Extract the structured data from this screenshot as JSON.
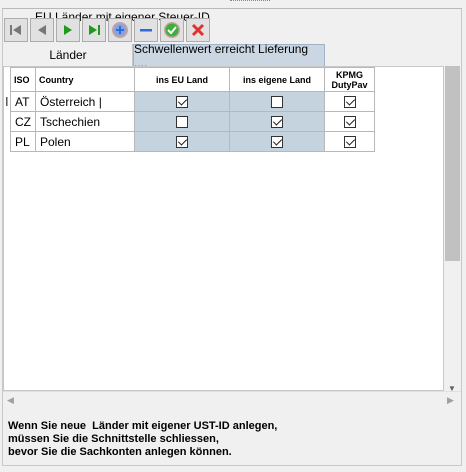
{
  "group_title": "EU Länder mit eigener Steuer-ID",
  "toolbar": {
    "buttons": [
      {
        "name": "first-record-button",
        "icon": "first-icon"
      },
      {
        "name": "prior-record-button",
        "icon": "prior-icon"
      },
      {
        "name": "next-record-button",
        "icon": "next-icon"
      },
      {
        "name": "last-record-button",
        "icon": "last-icon"
      },
      {
        "name": "insert-record-button",
        "icon": "plus-icon"
      },
      {
        "name": "delete-record-button",
        "icon": "minus-icon"
      },
      {
        "name": "post-record-button",
        "icon": "check-icon"
      },
      {
        "name": "cancel-record-button",
        "icon": "x-icon"
      }
    ]
  },
  "tabs": [
    {
      "label": "Länder",
      "active": false
    },
    {
      "label": "Schwellenwert erreicht Lieferung ....",
      "active": true
    }
  ],
  "table": {
    "headers": {
      "iso": "ISO",
      "country": "Country",
      "ins_eu_land": "ins EU Land",
      "ins_eigene_land": "ins eigene Land",
      "kpmg_line1": "KPMG",
      "kpmg_line2": "DutyPav"
    },
    "rows": [
      {
        "iso": "AT",
        "country": "Österreich",
        "ins_eu_land": true,
        "ins_eigene_land": false,
        "kpmg": true
      },
      {
        "iso": "CZ",
        "country": "Tschechien",
        "ins_eu_land": false,
        "ins_eigene_land": true,
        "kpmg": true
      },
      {
        "iso": "PL",
        "country": "Polen",
        "ins_eu_land": true,
        "ins_eigene_land": true,
        "kpmg": true
      }
    ]
  },
  "note": {
    "line1": "Wenn Sie neue  Länder mit eigener UST-ID anlegen,",
    "line2": "müssen Sie die Schnittstelle schliessen,",
    "line3": "bevor Sie die Sachkonten anlegen können."
  },
  "colors": {
    "shade": "#c5d3df",
    "tab_active": "#cad7e3",
    "green": "#1f9a1f",
    "blue": "#2b6cd8",
    "red": "#e03030"
  }
}
